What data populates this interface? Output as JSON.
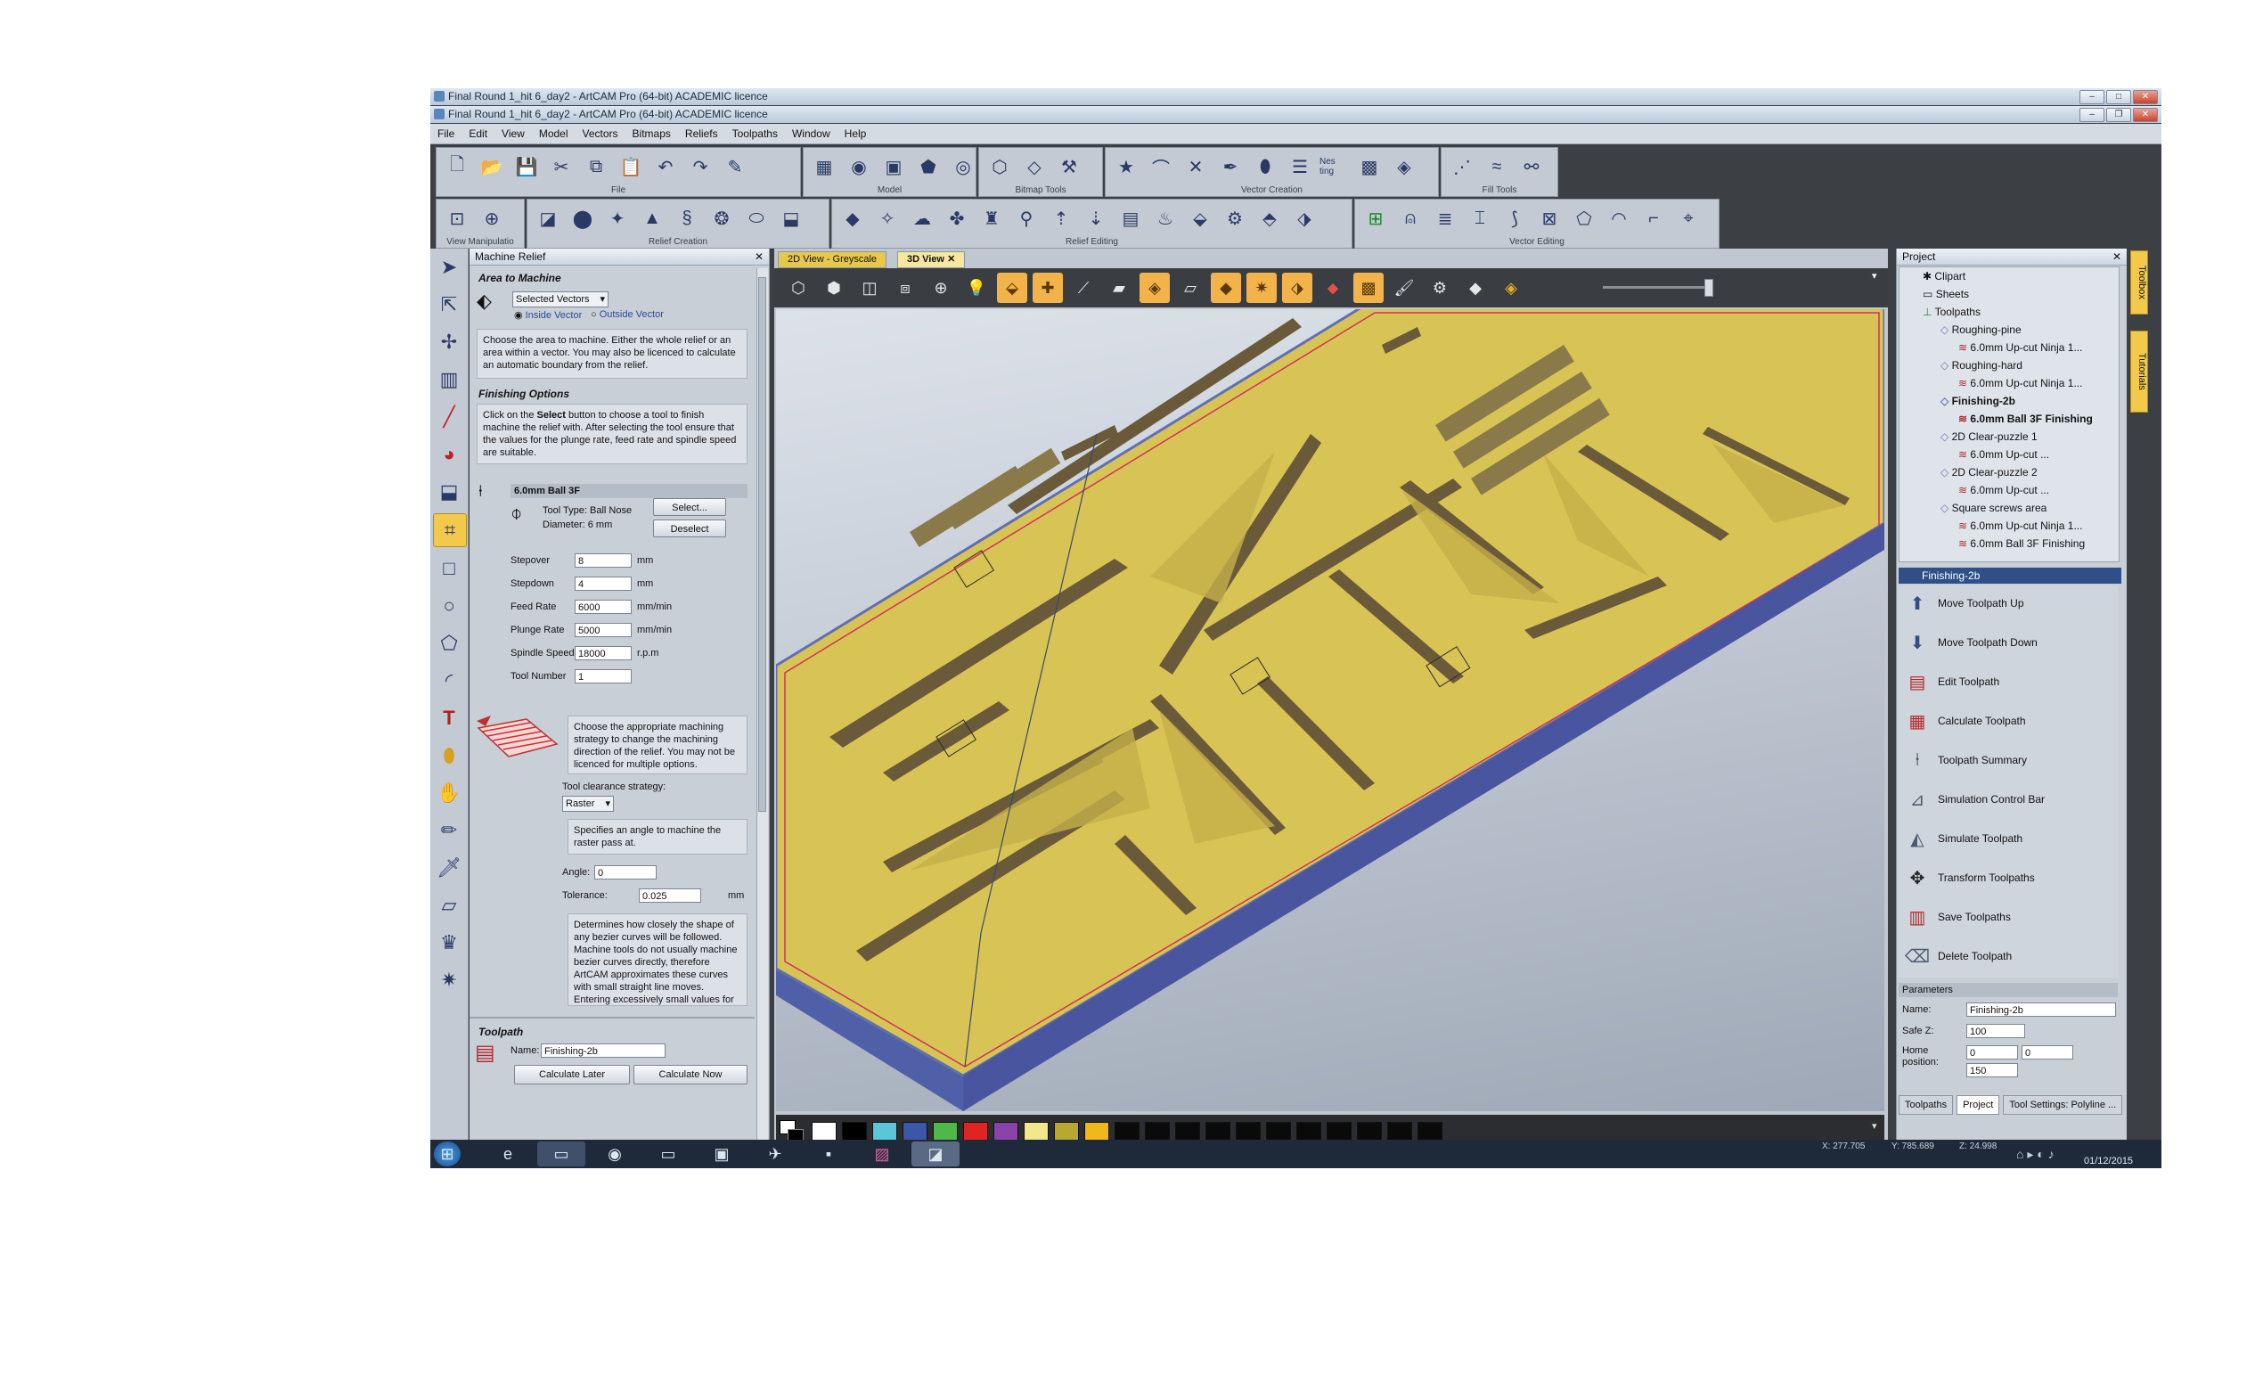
{
  "window": {
    "title_back": "Final Round 1_hit 6_day2 - ArtCAM Pro (64-bit) ACADEMIC licence",
    "title_front": "Final Round 1_hit 6_day2 - ArtCAM Pro (64-bit) ACADEMIC licence"
  },
  "menu": [
    "File",
    "Edit",
    "View",
    "Model",
    "Vectors",
    "Bitmaps",
    "Reliefs",
    "Toolpaths",
    "Window",
    "Help"
  ],
  "toolbars": {
    "file": "File",
    "model": "Model",
    "bitmap_tools": "Bitmap Tools",
    "vector_creation": "Vector Creation",
    "fill_tools": "Fill Tools",
    "view_manipulation": "View Manipulatio",
    "relief_creation": "Relief Creation",
    "relief_editing": "Relief Editing",
    "vector_editing": "Vector Editing",
    "nesting_label": "Nes ting"
  },
  "machine_relief": {
    "panel_title": "Machine Relief",
    "area_heading": "Area to Machine",
    "area_select": "Selected Vectors",
    "inside_vector": "Inside Vector",
    "outside_vector": "Outside Vector",
    "area_desc": "Choose the area to machine. Either the whole relief or an area within a vector. You may also be licenced to calculate an automatic boundary from the relief.",
    "finishing_heading": "Finishing Options",
    "finishing_desc_pre": "Click on the ",
    "finishing_desc_bold": "Select",
    "finishing_desc_post": " button to choose a tool to finish machine the relief with. After selecting the tool ensure that the values for the plunge rate, feed rate and spindle speed are suitable.",
    "tool_name": "6.0mm Ball 3F",
    "tool_type": "Tool Type: Ball Nose",
    "diameter": "Diameter:  6 mm",
    "select_btn": "Select...",
    "deselect_btn": "Deselect",
    "params": [
      {
        "label": "Stepover",
        "value": "8",
        "unit": "mm"
      },
      {
        "label": "Stepdown",
        "value": "4",
        "unit": "mm"
      },
      {
        "label": "Feed Rate",
        "value": "6000",
        "unit": "mm/min"
      },
      {
        "label": "Plunge Rate",
        "value": "5000",
        "unit": "mm/min"
      },
      {
        "label": "Spindle Speed",
        "value": "18000",
        "unit": "r.p.m"
      },
      {
        "label": "Tool Number",
        "value": "1",
        "unit": ""
      }
    ],
    "strategy_desc": "Choose the appropriate machining strategy to change the machining direction of the relief. You may not be licenced for multiple options.",
    "clearance_label": "Tool clearance strategy:",
    "clearance_value": "Raster",
    "angle_desc": "Specifies an angle to machine the raster pass at.",
    "angle_label": "Angle:",
    "angle_value": "0",
    "tolerance_label": "Tolerance:",
    "tolerance_value": "0.025",
    "tolerance_unit": "mm",
    "tolerance_desc": "Determines how closely the shape of any bezier curves will be followed. Machine tools do not usually machine bezier curves directly, therefore ArtCAM approximates these curves with small straight line moves. Entering excessively small values for this tolerance will increase toolpath",
    "toolpath_heading": "Toolpath",
    "name_label": "Name:",
    "name_value": "Finishing-2b",
    "calc_later": "Calculate Later",
    "calc_now": "Calculate Now"
  },
  "view_tabs": [
    "2D View - Greyscale",
    "3D View"
  ],
  "palette": [
    "#ffffff",
    "#000000",
    "#5bc6d8",
    "#3a57a8",
    "#4fb848",
    "#e02424",
    "#8a43a8",
    "#f0e88a",
    "#b8a830",
    "#f0b818"
  ],
  "project": {
    "title": "Project",
    "tree": [
      {
        "label": "Clipart",
        "level": 1,
        "bold": false
      },
      {
        "label": "Sheets",
        "level": 1,
        "bold": false
      },
      {
        "label": "Toolpaths",
        "level": 1,
        "bold": false
      },
      {
        "label": "Roughing-pine",
        "level": 2,
        "bold": false
      },
      {
        "label": "6.0mm Up-cut Ninja 1...",
        "level": 3,
        "bold": false
      },
      {
        "label": "Roughing-hard",
        "level": 2,
        "bold": false
      },
      {
        "label": "6.0mm Up-cut Ninja 1...",
        "level": 3,
        "bold": false
      },
      {
        "label": "Finishing-2b",
        "level": 2,
        "bold": true
      },
      {
        "label": "6.0mm Ball 3F Finishing",
        "level": 3,
        "bold": true
      },
      {
        "label": "2D Clear-puzzle 1",
        "level": 2,
        "bold": false
      },
      {
        "label": "6.0mm Up-cut ...",
        "level": 3,
        "bold": false
      },
      {
        "label": "2D Clear-puzzle 2",
        "level": 2,
        "bold": false
      },
      {
        "label": "6.0mm Up-cut ...",
        "level": 3,
        "bold": false
      },
      {
        "label": "Square screws area",
        "level": 2,
        "bold": false
      },
      {
        "label": "6.0mm Up-cut Ninja 1...",
        "level": 3,
        "bold": false
      },
      {
        "label": "6.0mm Ball 3F Finishing",
        "level": 3,
        "bold": false
      }
    ],
    "selected_title": "Finishing-2b",
    "actions": [
      "Move Toolpath Up",
      "Move Toolpath Down",
      "Edit Toolpath",
      "Calculate Toolpath",
      "Toolpath Summary",
      "Simulation Control Bar",
      "Simulate Toolpath",
      "Transform Toolpaths",
      "Save Toolpaths",
      "Delete Toolpath"
    ],
    "parameters_heading": "Parameters",
    "param_name_label": "Name:",
    "param_name_value": "Finishing-2b",
    "safe_z_label": "Safe Z:",
    "safe_z_value": "100",
    "home_label": "Home position:",
    "home_x": "0",
    "home_y": "0",
    "home_z": "150",
    "bottom_tabs": [
      "Toolpaths",
      "Project",
      "Tool Settings: Polyline ..."
    ]
  },
  "side_tabs": [
    "Toolbox",
    "Tutorials"
  ],
  "status": {
    "x": "X: 277.705",
    "y": "Y: 785.689",
    "z": "Z: 24.998",
    "date": "01/12/2015"
  }
}
